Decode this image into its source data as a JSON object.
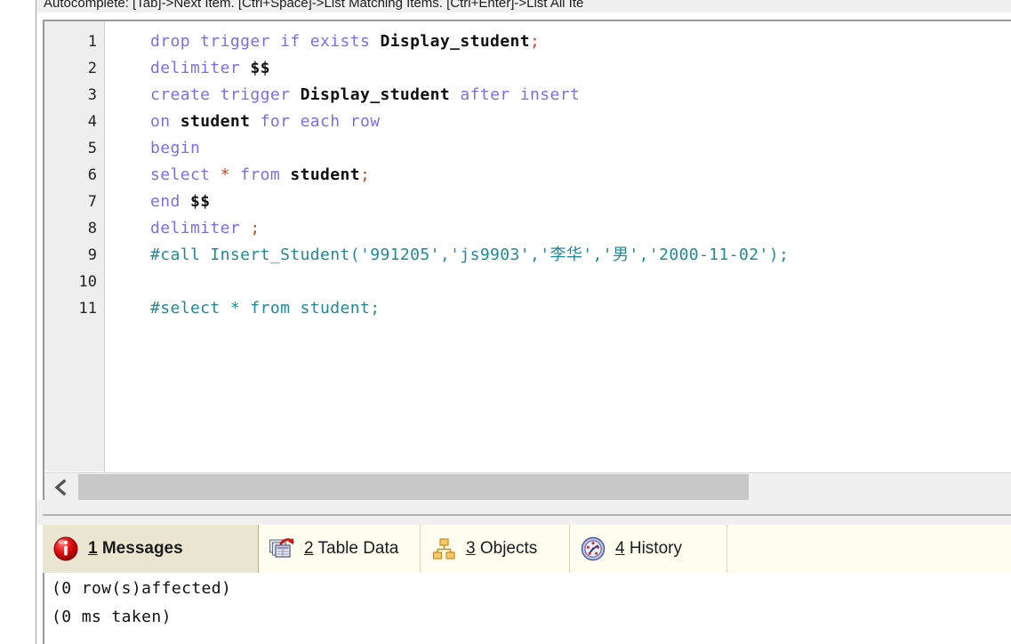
{
  "hint_bar": {
    "text": "Autocomplete: [Tab]->Next Item. [Ctrl+Space]->List Matching Items. [Ctrl+Enter]->List All Ite"
  },
  "editor": {
    "line_numbers": [
      "1",
      "2",
      "3",
      "4",
      "5",
      "6",
      "7",
      "8",
      "9",
      "10",
      "11"
    ],
    "lines": [
      {
        "n": "1",
        "text": "drop trigger if exists Display_student;"
      },
      {
        "n": "2",
        "text": "delimiter $$"
      },
      {
        "n": "3",
        "text": "create trigger Display_student after insert"
      },
      {
        "n": "4",
        "text": "on student for each row"
      },
      {
        "n": "5",
        "text": "begin"
      },
      {
        "n": "6",
        "text": "select * from student;"
      },
      {
        "n": "7",
        "text": "end $$"
      },
      {
        "n": "8",
        "text": "delimiter ;"
      },
      {
        "n": "9",
        "text": "#call Insert_Student('991205','js9903','李华','男','2000-11-02');"
      },
      {
        "n": "10",
        "text": ""
      },
      {
        "n": "11",
        "text": "#select * from student;"
      }
    ],
    "tokens": [
      [
        {
          "t": "drop trigger if exists ",
          "c": "kw"
        },
        {
          "t": "Display_student",
          "c": "id"
        },
        {
          "t": ";",
          "c": "op"
        }
      ],
      [
        {
          "t": "delimiter ",
          "c": "kw"
        },
        {
          "t": "$$",
          "c": "punc"
        }
      ],
      [
        {
          "t": "create trigger ",
          "c": "kw"
        },
        {
          "t": "Display_student",
          "c": "id"
        },
        {
          "t": " after insert",
          "c": "kw"
        }
      ],
      [
        {
          "t": "on ",
          "c": "kw"
        },
        {
          "t": "student",
          "c": "id"
        },
        {
          "t": " for each row",
          "c": "kw"
        }
      ],
      [
        {
          "t": "begin",
          "c": "kw"
        }
      ],
      [
        {
          "t": "select ",
          "c": "kw"
        },
        {
          "t": "*",
          "c": "op"
        },
        {
          "t": " from ",
          "c": "kw"
        },
        {
          "t": "student",
          "c": "id"
        },
        {
          "t": ";",
          "c": "op"
        }
      ],
      [
        {
          "t": "end ",
          "c": "kw"
        },
        {
          "t": "$$",
          "c": "punc"
        }
      ],
      [
        {
          "t": "delimiter ",
          "c": "kw"
        },
        {
          "t": ";",
          "c": "op"
        }
      ],
      [
        {
          "t": "#call Insert_Student('991205','js9903','李华','男','2000-11-02');",
          "c": "cmt"
        }
      ],
      [],
      [
        {
          "t": "#select * from student;",
          "c": "cmt"
        }
      ]
    ],
    "scrollbar": {
      "left_arrow_icon": "chevron-left-icon",
      "thumb_label": "horizontal-scroll-thumb"
    }
  },
  "results": {
    "tabs": [
      {
        "accel": "1",
        "label": " Messages",
        "icon": "info-circle-icon",
        "active": true,
        "name": "tab-messages"
      },
      {
        "accel": "2",
        "label": " Table Data",
        "icon": "table-data-icon",
        "active": false,
        "name": "tab-table-data"
      },
      {
        "accel": "3",
        "label": " Objects",
        "icon": "objects-tree-icon",
        "active": false,
        "name": "tab-objects"
      },
      {
        "accel": "4",
        "label": " History",
        "icon": "history-clock-icon",
        "active": false,
        "name": "tab-history"
      }
    ],
    "messages": [
      "(0 row(s)affected)",
      "(0 ms taken)"
    ]
  },
  "colors": {
    "keyword": "#7b6fe8",
    "identifier": "#111111",
    "comment": "#1f8a95",
    "operator": "#c04a28",
    "gutter_bg": "#eeeeee",
    "tabbar_bg": "#fffdf0",
    "active_tab_bg": "#ebe6d2",
    "scroll_thumb": "#c8c8c8",
    "error_icon": "#d40000"
  }
}
